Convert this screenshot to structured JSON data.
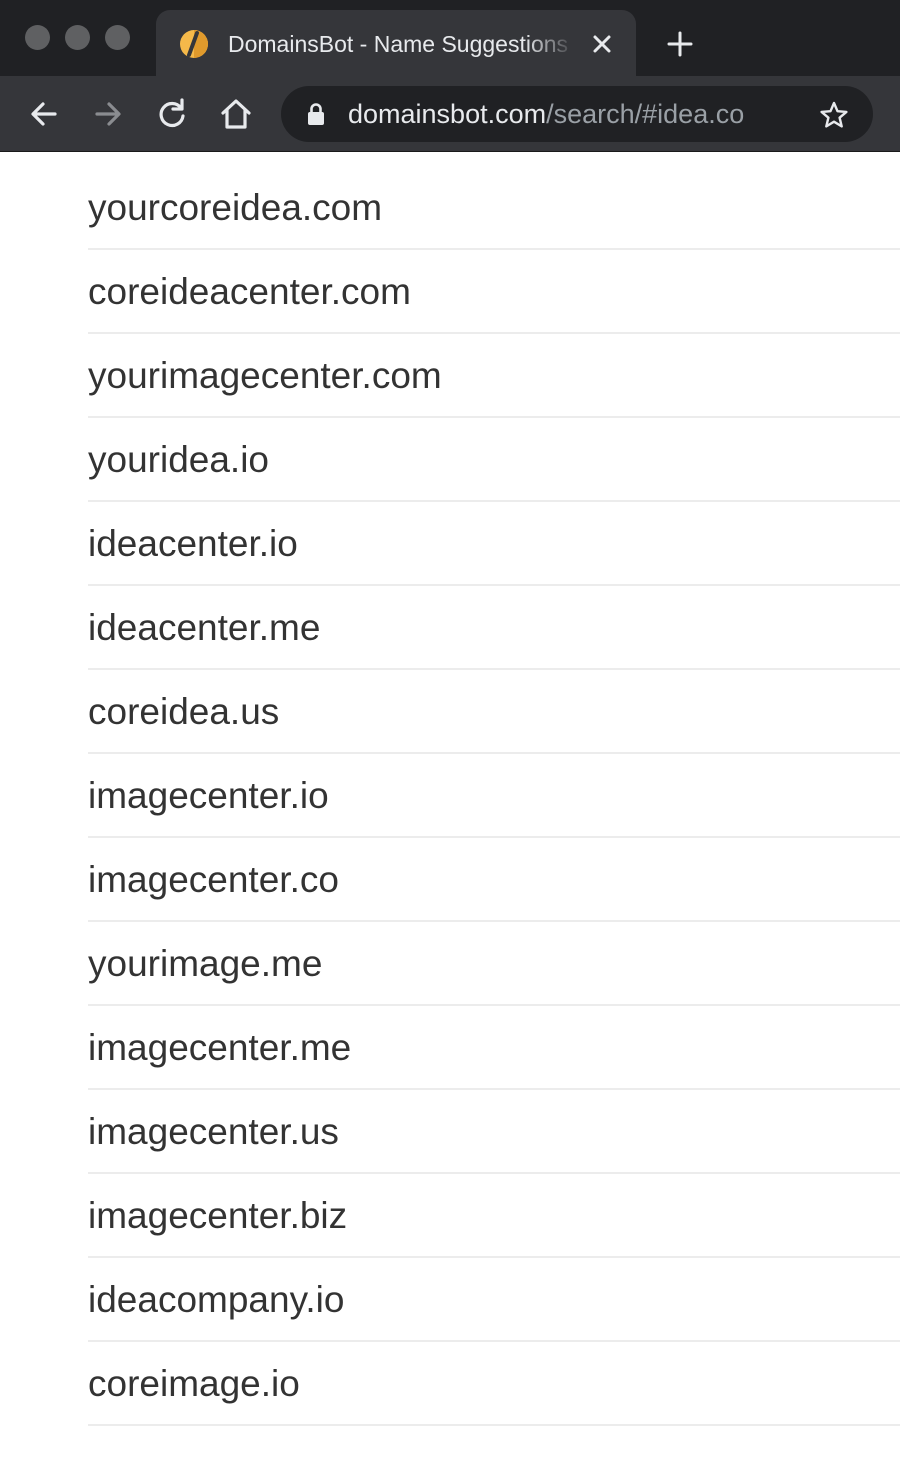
{
  "browser": {
    "tab": {
      "title": "DomainsBot - Name Suggestions",
      "favicon": "domainsbot-logo-icon"
    },
    "url": {
      "host": "domainsbot.com",
      "path": "/search/#idea.co"
    },
    "icons": {
      "back": "arrow-left-icon",
      "forward": "arrow-right-icon",
      "reload": "reload-icon",
      "home": "home-icon",
      "lock": "lock-icon",
      "bookmark": "star-icon",
      "close_tab": "close-icon",
      "new_tab": "plus-icon"
    },
    "colors": {
      "tabstrip": "#202124",
      "toolbar": "#35363a",
      "favicon_accent": "#f5b94a"
    }
  },
  "domains": [
    {
      "name": "yourcoreidea.com"
    },
    {
      "name": "coreideacenter.com"
    },
    {
      "name": "yourimagecenter.com"
    },
    {
      "name": "youridea.io"
    },
    {
      "name": "ideacenter.io"
    },
    {
      "name": "ideacenter.me"
    },
    {
      "name": "coreidea.us"
    },
    {
      "name": "imagecenter.io"
    },
    {
      "name": "imagecenter.co"
    },
    {
      "name": "yourimage.me"
    },
    {
      "name": "imagecenter.me"
    },
    {
      "name": "imagecenter.us"
    },
    {
      "name": "imagecenter.biz"
    },
    {
      "name": "ideacompany.io"
    },
    {
      "name": "coreimage.io"
    }
  ]
}
